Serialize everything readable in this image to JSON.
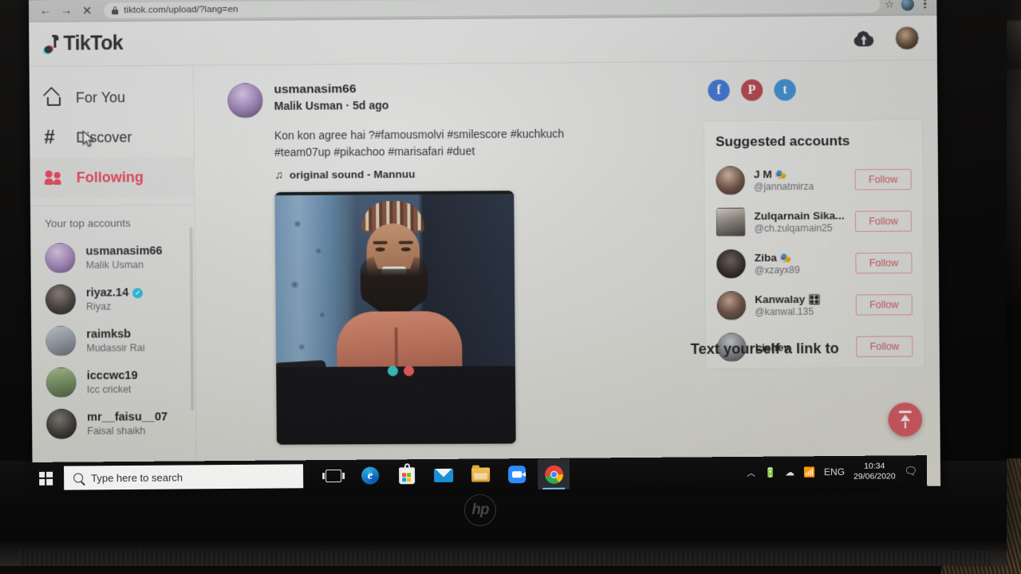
{
  "browser": {
    "url": "tiktok.com/upload/?lang=en",
    "back_label": "←",
    "forward_label": "→",
    "stop_label": "✕",
    "star_label": "☆"
  },
  "header": {
    "brand": "TikTok",
    "upload_icon": "upload-cloud-icon",
    "avatar_icon": "profile-avatar"
  },
  "sidebar": {
    "nav": [
      {
        "label": "For You",
        "icon": "home-icon",
        "active": false
      },
      {
        "label": "Discover",
        "icon": "hashtag-icon",
        "active": false
      },
      {
        "label": "Following",
        "icon": "people-icon",
        "active": true
      }
    ],
    "section_title": "Your top accounts",
    "accounts": [
      {
        "username": "usmanasim66",
        "display_name": "Malik Usman",
        "verified": false
      },
      {
        "username": "riyaz.14",
        "display_name": "Riyaz",
        "verified": true
      },
      {
        "username": "raimksb",
        "display_name": "Mudassir Rai",
        "verified": false
      },
      {
        "username": "icccwc19",
        "display_name": "Icc cricket",
        "verified": false
      },
      {
        "username": "mr__faisu__07",
        "display_name": "Faisal shaikh",
        "verified": false
      }
    ]
  },
  "post": {
    "username": "usmanasim66",
    "meta": "Malik Usman · 5d ago",
    "caption": "Kon kon agree hai ?#famousmolvi #smilescore #kuchkuch #team07up #pikachoo #marisafari #duet",
    "sound": "original sound - Mannuu",
    "sound_icon": "music-note-icon",
    "loading_dot_teal": "#2ec9c4",
    "loading_dot_red": "#ee5a5a"
  },
  "share": {
    "facebook": "f",
    "pinterest": "P",
    "twitter": "t"
  },
  "suggested": {
    "title": "Suggested accounts",
    "follow_label": "Follow",
    "accounts": [
      {
        "name": "J M",
        "badge": "🎭",
        "handle": "@jannatmirza",
        "follow": "Follow"
      },
      {
        "name": "Zulqarnain Sika...",
        "badge": "",
        "handle": "@ch.zulqarnain25",
        "follow": "Follow"
      },
      {
        "name": "Ziba",
        "badge": "🎭",
        "handle": "@xzayx89",
        "follow": "Follow"
      },
      {
        "name": "Kanwalay",
        "badge": "🎛",
        "handle": "@kanwal.135",
        "follow": "Follow"
      },
      {
        "name": "Lishev",
        "badge": "",
        "handle": "",
        "follow": "Follow"
      }
    ]
  },
  "rail_footer": "Text yourself a link to",
  "status_bar": {
    "url": "https://www.tiktok.com/following?lang=en"
  },
  "taskbar": {
    "search_placeholder": "Type here to search",
    "icons": [
      "task-view-icon",
      "edge-icon",
      "microsoft-store-icon",
      "mail-icon",
      "file-explorer-icon",
      "zoom-icon",
      "chrome-icon"
    ],
    "tray": {
      "chevron": "︿",
      "battery": "battery-icon",
      "onedrive": "onedrive-icon",
      "wifi": "wifi-icon",
      "language": "ENG",
      "time": "10:34",
      "date": "29/06/2020",
      "notifications": "notification-icon"
    }
  },
  "device": {
    "brand": "hp"
  },
  "colors": {
    "tiktok_red": "#e8384f",
    "tiktok_teal": "#25f4ee",
    "follow_border": "#e8919b",
    "page_bg": "#e2e3e1"
  }
}
